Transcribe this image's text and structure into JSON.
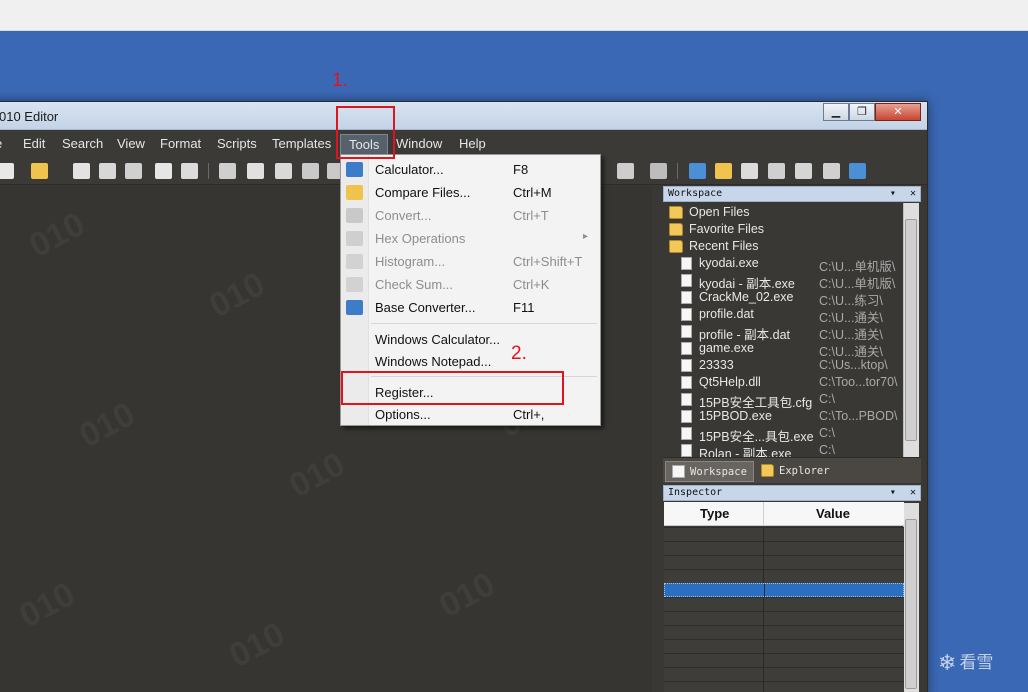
{
  "window": {
    "title": "010 Editor"
  },
  "window_controls": {
    "minimize": "▁",
    "restore": "❐",
    "close": "✕"
  },
  "menubar": [
    "e",
    "Edit",
    "Search",
    "View",
    "Format",
    "Scripts",
    "Templates",
    "Tools",
    "Window",
    "Help"
  ],
  "tools_menu": {
    "items": [
      {
        "label": "Calculator...",
        "shortcut": "F8",
        "disabled": false,
        "icon": "calculator-icon"
      },
      {
        "label": "Compare Files...",
        "shortcut": "Ctrl+M",
        "disabled": false,
        "icon": "compare-icon"
      },
      {
        "label": "Convert...",
        "shortcut": "Ctrl+T",
        "disabled": true,
        "icon": "convert-icon"
      },
      {
        "label": "Hex Operations",
        "shortcut": "",
        "disabled": true,
        "icon": "hex-ops-icon",
        "submenu": "▸"
      },
      {
        "label": "Histogram...",
        "shortcut": "Ctrl+Shift+T",
        "disabled": true,
        "icon": "histogram-icon"
      },
      {
        "label": "Check Sum...",
        "shortcut": "Ctrl+K",
        "disabled": true,
        "icon": "checksum-icon"
      },
      {
        "label": "Base Converter...",
        "shortcut": "F11",
        "disabled": false,
        "icon": "base-converter-icon"
      },
      {
        "label": "Windows Calculator...",
        "shortcut": "",
        "disabled": false
      },
      {
        "label": "Windows Notepad...",
        "shortcut": "",
        "disabled": false
      },
      {
        "label": "Register...",
        "shortcut": "",
        "disabled": false
      },
      {
        "label": "Options...",
        "shortcut": "Ctrl+,",
        "disabled": false
      }
    ]
  },
  "annotations": {
    "step1": "1.",
    "step2": "2.",
    "color": "#e0141e"
  },
  "workspace": {
    "title": "Workspace",
    "pane_buttons": {
      "menu": "▾",
      "close": "✕"
    },
    "groups": [
      "Open Files",
      "Favorite Files",
      "Recent Files"
    ],
    "recent_files": [
      {
        "name": "kyodai.exe",
        "path": "C:\\U...单机版\\"
      },
      {
        "name": "kyodai - 副本.exe",
        "path": "C:\\U...单机版\\"
      },
      {
        "name": "CrackMe_02.exe",
        "path": "C:\\U...练习\\"
      },
      {
        "name": "profile.dat",
        "path": "C:\\U...通关\\"
      },
      {
        "name": "profile - 副本.dat",
        "path": "C:\\U...通关\\"
      },
      {
        "name": "game.exe",
        "path": "C:\\U...通关\\"
      },
      {
        "name": "23333",
        "path": "C:\\Us...ktop\\"
      },
      {
        "name": "Qt5Help.dll",
        "path": "C:\\Too...tor70\\"
      },
      {
        "name": "15PB安全工具包.cfg",
        "path": "C:\\"
      },
      {
        "name": "15PBOD.exe",
        "path": "C:\\To...PBOD\\"
      },
      {
        "name": "15PB安全...具包.exe",
        "path": "C:\\"
      },
      {
        "name": "Rolan - 副本.exe",
        "path": "C:\\"
      }
    ]
  },
  "bottom_tabs": [
    {
      "label": "Workspace",
      "active": true
    },
    {
      "label": "Explorer",
      "active": false
    }
  ],
  "inspector": {
    "title": "Inspector",
    "columns": [
      "Type",
      "Value"
    ],
    "selected_row": 4
  },
  "watermark": {
    "logo_text": "看雪",
    "glyph": "❄"
  },
  "editor_watermark_text": "010"
}
